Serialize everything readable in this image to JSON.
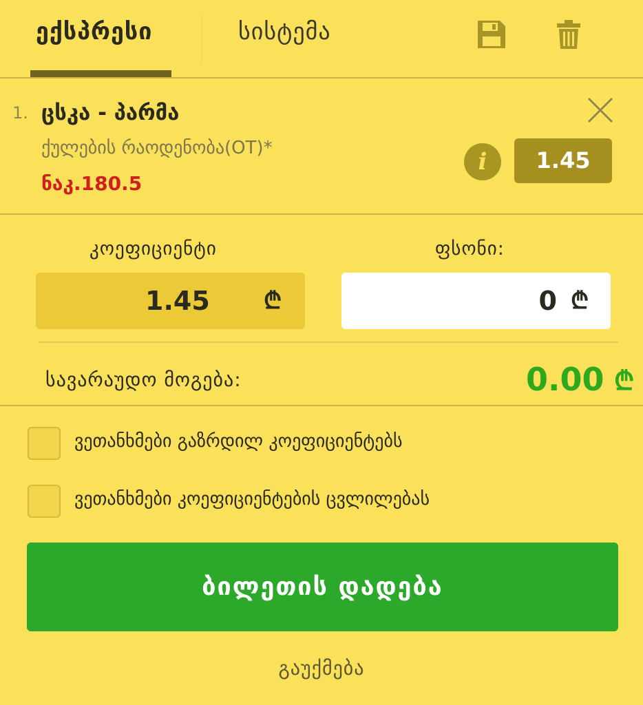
{
  "tabs": {
    "express": "ექსპრესი",
    "system": "სისტემა",
    "save_icon": "save-icon",
    "delete_icon": "trash-icon"
  },
  "bet": {
    "index": "1.",
    "match": "ცსკა - პარმა",
    "market": "ქულების რაოდენობა(OT)*",
    "line": "ნაკ.180.5",
    "odds": "1.45",
    "info_icon": "i"
  },
  "form": {
    "odds_label": "კოეფიციენტი",
    "odds_value": "1.45",
    "stake_label": "ფსონი:",
    "stake_value": "0",
    "currency": "₾"
  },
  "win": {
    "label": "სავარაუდო მოგება:",
    "value": "0.00",
    "currency": "₾"
  },
  "options": {
    "accept_increased": "ვეთანხმები გაზრდილ კოეფიციენტებს",
    "accept_changes": "ვეთანხმები კოეფიციენტების ცვლილებას"
  },
  "actions": {
    "place_bet": "ბილეთის დადება",
    "cancel": "გაუქმება"
  },
  "colors": {
    "background": "#fbe05a",
    "accent_dark": "#a58f1e",
    "success": "#2ca82a",
    "line_red": "#cf1f1f"
  }
}
